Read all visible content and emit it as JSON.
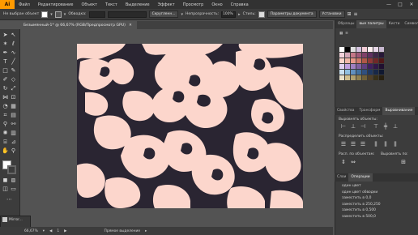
{
  "app": {
    "logo": "Ai"
  },
  "menu": [
    "Файл",
    "Редактирование",
    "Объект",
    "Текст",
    "Выделение",
    "Эффект",
    "Просмотр",
    "Окно",
    "Справка"
  ],
  "window_controls": [
    "—",
    "□",
    "✕"
  ],
  "control_bar": {
    "no_selection": "Не выбран объект",
    "stroke_label": "Обводка:",
    "stroke_value": "",
    "style_preset": "Скругленн...",
    "opacity_label": "Непрозрачность:",
    "opacity_value": "100%",
    "style_label": "Стиль:",
    "doc_params_button": "Параметры документа",
    "prefs_button": "Установки"
  },
  "document_tab": {
    "title": "Безымянный-1* @ 66,67% (RGB/Предпросмотр GPU)",
    "close": "✕"
  },
  "status_bar": {
    "zoom": "66,67%",
    "page": "1",
    "tool": "Прямое выделение"
  },
  "mini_window": {
    "label": "Mirror..."
  },
  "panels": {
    "top_tabs": [
      "Образцы",
      "Кисти",
      "Символы"
    ],
    "swatches_tab_label": "Образцы",
    "swatch_lib_label": "вые палитры",
    "middle_tabs": [
      "Свойства",
      "Трансформ",
      "Выравнивание"
    ],
    "align": {
      "objects": "Выровнять объекты:",
      "distribute": "Распределить объекты:",
      "spacing": "Расп. по объектам:",
      "align_to": "Выровнять по:"
    },
    "bottom_tabs": [
      "Слои",
      "Операции"
    ],
    "actions": [
      "один цвет",
      "один цвет обводки",
      "заместить в 0,0",
      "заместить в 250,250",
      "заместить в 0,500",
      "заместить в 500,0"
    ]
  },
  "colors": {
    "artwork_light": "#fcd6cc",
    "artwork_dark": "#2a2532",
    "accent_orange": "#ff9a00",
    "swatches": [
      "#ffffff",
      "#000000",
      "#e0e0e0",
      "#d4c2e0",
      "#f2ccd6",
      "#fff0f0",
      "#e8d8e8",
      "#c8b8d0",
      "#f4d4dc",
      "#d4a8b8",
      "#c47888",
      "#a05878",
      "#804068",
      "#603060",
      "#402848",
      "#281838",
      "#fcd6cc",
      "#f0b8a8",
      "#e89888",
      "#d07868",
      "#b05848",
      "#903838",
      "#702828",
      "#501818",
      "#e0d0f0",
      "#c0a0e0",
      "#a080c0",
      "#8060a0",
      "#604080",
      "#402060",
      "#301848",
      "#201030",
      "#c8e0f0",
      "#90c0e0",
      "#6090c0",
      "#4070a0",
      "#305080",
      "#203860",
      "#182848",
      "#101830",
      "#e8e0c8",
      "#d0c090",
      "#b0a070",
      "#908050",
      "#706038",
      "#504028",
      "#383018",
      "#282010"
    ],
    "fill_swatch": "#ffffff",
    "stroke_swatch": "#555555"
  }
}
